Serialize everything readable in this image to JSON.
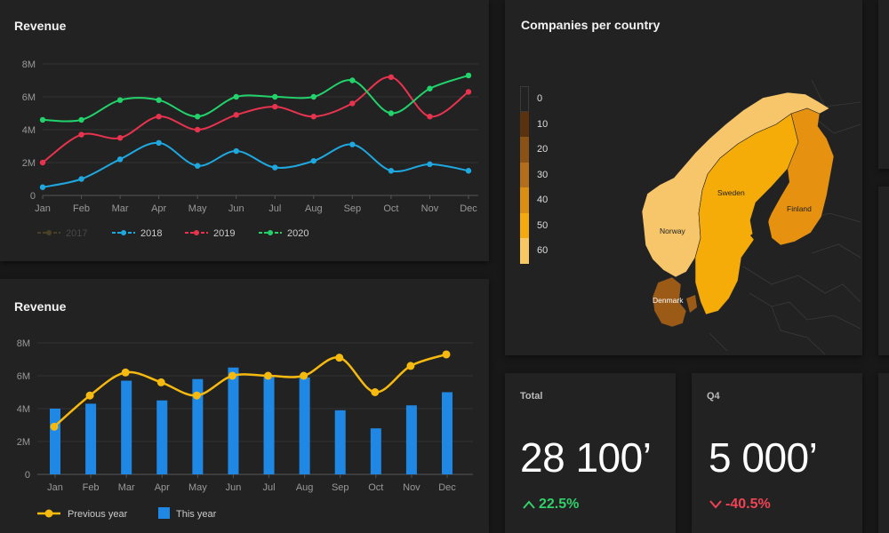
{
  "revenue_line_card": {
    "title": "Revenue"
  },
  "revenue_bar_card": {
    "title": "Revenue"
  },
  "map_card": {
    "title": "Companies per country",
    "legend": [
      {
        "label": "0",
        "color": "#222222"
      },
      {
        "label": "10",
        "color": "#5a3210"
      },
      {
        "label": "20",
        "color": "#8a5217"
      },
      {
        "label": "30",
        "color": "#b36e1c"
      },
      {
        "label": "40",
        "color": "#db8f12"
      },
      {
        "label": "50",
        "color": "#f4aa0c"
      },
      {
        "label": "60",
        "color": "#f7c763"
      }
    ],
    "countries": [
      {
        "name": "Norway",
        "color": "#f7c66a"
      },
      {
        "name": "Sweden",
        "color": "#f5ab08"
      },
      {
        "name": "Finland",
        "color": "#e69210"
      },
      {
        "name": "Denmark",
        "color": "#9c5a17"
      }
    ]
  },
  "kpi_total": {
    "label": "Total",
    "value": "28 100’",
    "change": "22.5%",
    "direction": "up",
    "color": "#31d06a"
  },
  "kpi_q4": {
    "label": "Q4",
    "value": "5 000’",
    "change": "-40.5%",
    "direction": "down",
    "color": "#f04354"
  },
  "chart_data": [
    {
      "type": "line",
      "title": "Revenue",
      "categories": [
        "Jan",
        "Feb",
        "Mar",
        "Apr",
        "May",
        "Jun",
        "Jul",
        "Aug",
        "Sep",
        "Oct",
        "Nov",
        "Dec"
      ],
      "y_ticks": [
        "0",
        "2M",
        "4M",
        "6M",
        "8M"
      ],
      "ylim": [
        0,
        8000000
      ],
      "series": [
        {
          "name": "2017",
          "color": "#6b5a2a",
          "hidden": true,
          "values": []
        },
        {
          "name": "2018",
          "color": "#1fa8e0",
          "values": [
            500000,
            1000000,
            2200000,
            3200000,
            1800000,
            2700000,
            1700000,
            2100000,
            3100000,
            1500000,
            1900000,
            1500000
          ]
        },
        {
          "name": "2019",
          "color": "#e8334f",
          "values": [
            2000000,
            3700000,
            3500000,
            4800000,
            4000000,
            4900000,
            5400000,
            4800000,
            5600000,
            7200000,
            4800000,
            6300000
          ]
        },
        {
          "name": "2020",
          "color": "#22d36c",
          "values": [
            4600000,
            4600000,
            5800000,
            5800000,
            4800000,
            6000000,
            6000000,
            6000000,
            7000000,
            5000000,
            6500000,
            7300000
          ]
        }
      ],
      "legend_position": "bottom-left",
      "grid": true
    },
    {
      "type": "bar",
      "title": "Revenue",
      "categories": [
        "Jan",
        "Feb",
        "Mar",
        "Apr",
        "May",
        "Jun",
        "Jul",
        "Aug",
        "Sep",
        "Oct",
        "Nov",
        "Dec"
      ],
      "y_ticks": [
        "0",
        "2M",
        "4M",
        "6M",
        "8M"
      ],
      "ylim": [
        0,
        8000000
      ],
      "series": [
        {
          "name": "Previous year",
          "type": "line",
          "color": "#f5b90f",
          "values": [
            2900000,
            4800000,
            6200000,
            5600000,
            4800000,
            6000000,
            6000000,
            6000000,
            7100000,
            5000000,
            6600000,
            7300000
          ]
        },
        {
          "name": "This year",
          "type": "bar",
          "color": "#1f88e5",
          "values": [
            4000000,
            4300000,
            5700000,
            4500000,
            5800000,
            6500000,
            6000000,
            5900000,
            3900000,
            2800000,
            4200000,
            5000000
          ]
        }
      ],
      "legend_position": "bottom-left",
      "grid": true
    }
  ]
}
